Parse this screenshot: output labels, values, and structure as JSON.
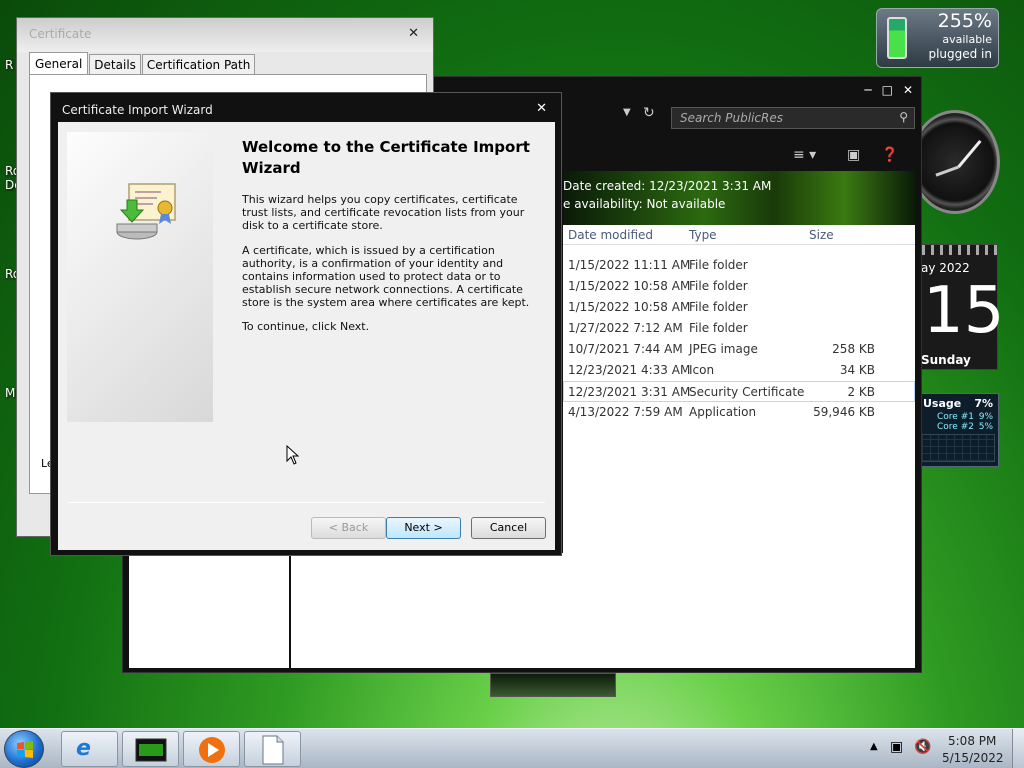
{
  "desktop": {
    "labels": [
      "R",
      "Ro",
      "De",
      "Ro",
      "M"
    ]
  },
  "gadgets": {
    "battery": {
      "percent": "255%",
      "line1": "available",
      "line2": "plugged in"
    },
    "calendar": {
      "month": "ay 2022",
      "day": "15",
      "weekday": "Sunday"
    },
    "cpu": {
      "title": "Usage",
      "total": "7%",
      "core1_label": "Core #1",
      "core1_value": "9%",
      "core2_label": "Core #2",
      "core2_value": "5%"
    }
  },
  "explorer": {
    "search_placeholder": "Search PublicRes",
    "details": {
      "created": "Date created: 12/23/2021 3:31 AM",
      "availability": "e availability:  Not available"
    },
    "columns": {
      "date": "Date modified",
      "type": "Type",
      "size": "Size"
    },
    "rows": [
      {
        "date": "1/15/2022 11:11 AM",
        "type": "File folder",
        "size": ""
      },
      {
        "date": "1/15/2022 10:58 AM",
        "type": "File folder",
        "size": ""
      },
      {
        "date": "1/15/2022 10:58 AM",
        "type": "File folder",
        "size": ""
      },
      {
        "date": "1/27/2022 7:12 AM",
        "type": "File folder",
        "size": ""
      },
      {
        "date": "10/7/2021 7:44 AM",
        "type": "JPEG image",
        "size": "258 KB"
      },
      {
        "date": "12/23/2021 4:33 AM",
        "type": "Icon",
        "size": "34 KB"
      },
      {
        "date": "12/23/2021 3:31 AM",
        "type": "Security Certificate",
        "size": "2 KB"
      },
      {
        "date": "4/13/2022 7:59 AM",
        "type": "Application",
        "size": "59,946 KB"
      }
    ]
  },
  "cert_dialog": {
    "title": "Certificate",
    "tabs": [
      "General",
      "Details",
      "Certification Path"
    ],
    "bottom_text": "Le"
  },
  "wizard": {
    "title": "Certificate Import Wizard",
    "heading": "Welcome to the Certificate Import Wizard",
    "para1": "This wizard helps you copy certificates, certificate trust lists, and certificate revocation lists from your disk to a certificate store.",
    "para2": "A certificate, which is issued by a certification authority, is a confirmation of your identity and contains information used to protect data or to establish secure network connections. A certificate store is the system area where certificates are kept.",
    "para3": "To continue, click Next.",
    "back": "< Back",
    "next": "Next >",
    "cancel": "Cancel"
  },
  "taskbar": {
    "time": "5:08 PM",
    "date": "5/15/2022"
  }
}
